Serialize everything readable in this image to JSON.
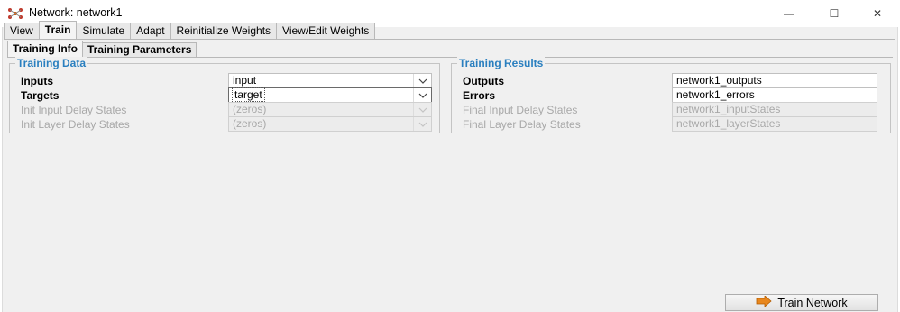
{
  "window": {
    "title": "Network: network1",
    "controls": {
      "minimize": "—",
      "maximize": "☐",
      "close": "✕"
    }
  },
  "top_tabs": [
    {
      "label": "View",
      "active": false
    },
    {
      "label": "Train",
      "active": true
    },
    {
      "label": "Simulate",
      "active": false
    },
    {
      "label": "Adapt",
      "active": false
    },
    {
      "label": "Reinitialize Weights",
      "active": false
    },
    {
      "label": "View/Edit Weights",
      "active": false
    }
  ],
  "sub_tabs": [
    {
      "label": "Training Info",
      "active": true
    },
    {
      "label": "Training Parameters",
      "active": false
    }
  ],
  "training_data": {
    "title": "Training Data",
    "rows": [
      {
        "label": "Inputs",
        "value": "input",
        "enabled": true
      },
      {
        "label": "Targets",
        "value": "target",
        "enabled": true,
        "focused": true
      },
      {
        "label": "Init Input Delay States",
        "value": "(zeros)",
        "enabled": false
      },
      {
        "label": "Init Layer Delay States",
        "value": "(zeros)",
        "enabled": false
      }
    ]
  },
  "training_results": {
    "title": "Training Results",
    "rows": [
      {
        "label": "Outputs",
        "value": "network1_outputs",
        "enabled": true
      },
      {
        "label": "Errors",
        "value": "network1_errors",
        "enabled": true
      },
      {
        "label": "Final Input Delay States",
        "value": "network1_inputStates",
        "enabled": false
      },
      {
        "label": "Final Layer Delay States",
        "value": "network1_layerStates",
        "enabled": false
      }
    ]
  },
  "actions": {
    "train_label": "Train Network"
  },
  "colors": {
    "group_title": "#2a7fbf",
    "disabled_text": "#a8a8a8"
  }
}
